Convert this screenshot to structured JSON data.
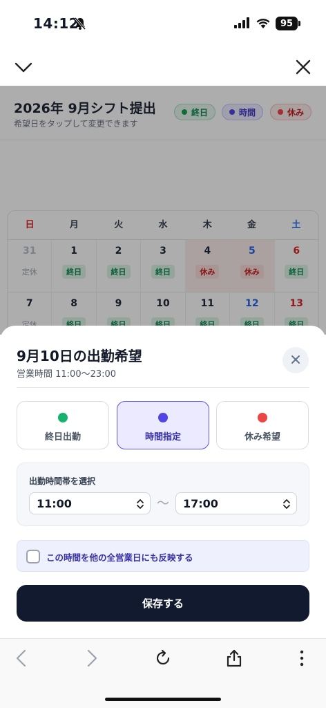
{
  "status_bar": {
    "time": "14:12",
    "battery": "95"
  },
  "page": {
    "title": "2026年 9月シフト提出",
    "subtitle": "希望日をタップして変更できます",
    "legend": {
      "all_day": "終日",
      "time": "時間",
      "off": "休み"
    },
    "weekdays": [
      "日",
      "月",
      "火",
      "水",
      "木",
      "金",
      "土"
    ],
    "week1": [
      {
        "day": "31",
        "tag": "定休"
      },
      {
        "day": "1",
        "tag": "終日"
      },
      {
        "day": "2",
        "tag": "終日"
      },
      {
        "day": "3",
        "tag": "終日"
      },
      {
        "day": "4",
        "tag": "休み"
      },
      {
        "day": "5",
        "tag": "休み"
      },
      {
        "day": "6",
        "tag": "終日"
      }
    ],
    "week2": [
      {
        "day": "7",
        "tag": "定休"
      },
      {
        "day": "8",
        "tag": "終日"
      },
      {
        "day": "9",
        "tag": "終日"
      },
      {
        "day": "10",
        "tag": "終日"
      },
      {
        "day": "11",
        "tag": "終日"
      },
      {
        "day": "12",
        "tag": "終日"
      },
      {
        "day": "13",
        "tag": "終日"
      }
    ]
  },
  "sheet": {
    "title": "9月10日の出勤希望",
    "hours": "営業時間 11:00〜23:00",
    "options": {
      "all_day": "終日出勤",
      "time": "時間指定",
      "off": "休み希望"
    },
    "time_label": "出勤時間帯を選択",
    "start": "11:00",
    "separator": "〜",
    "end": "17:00",
    "reflect": "この時間を他の全営業日にも反映する",
    "save": "保存する"
  }
}
